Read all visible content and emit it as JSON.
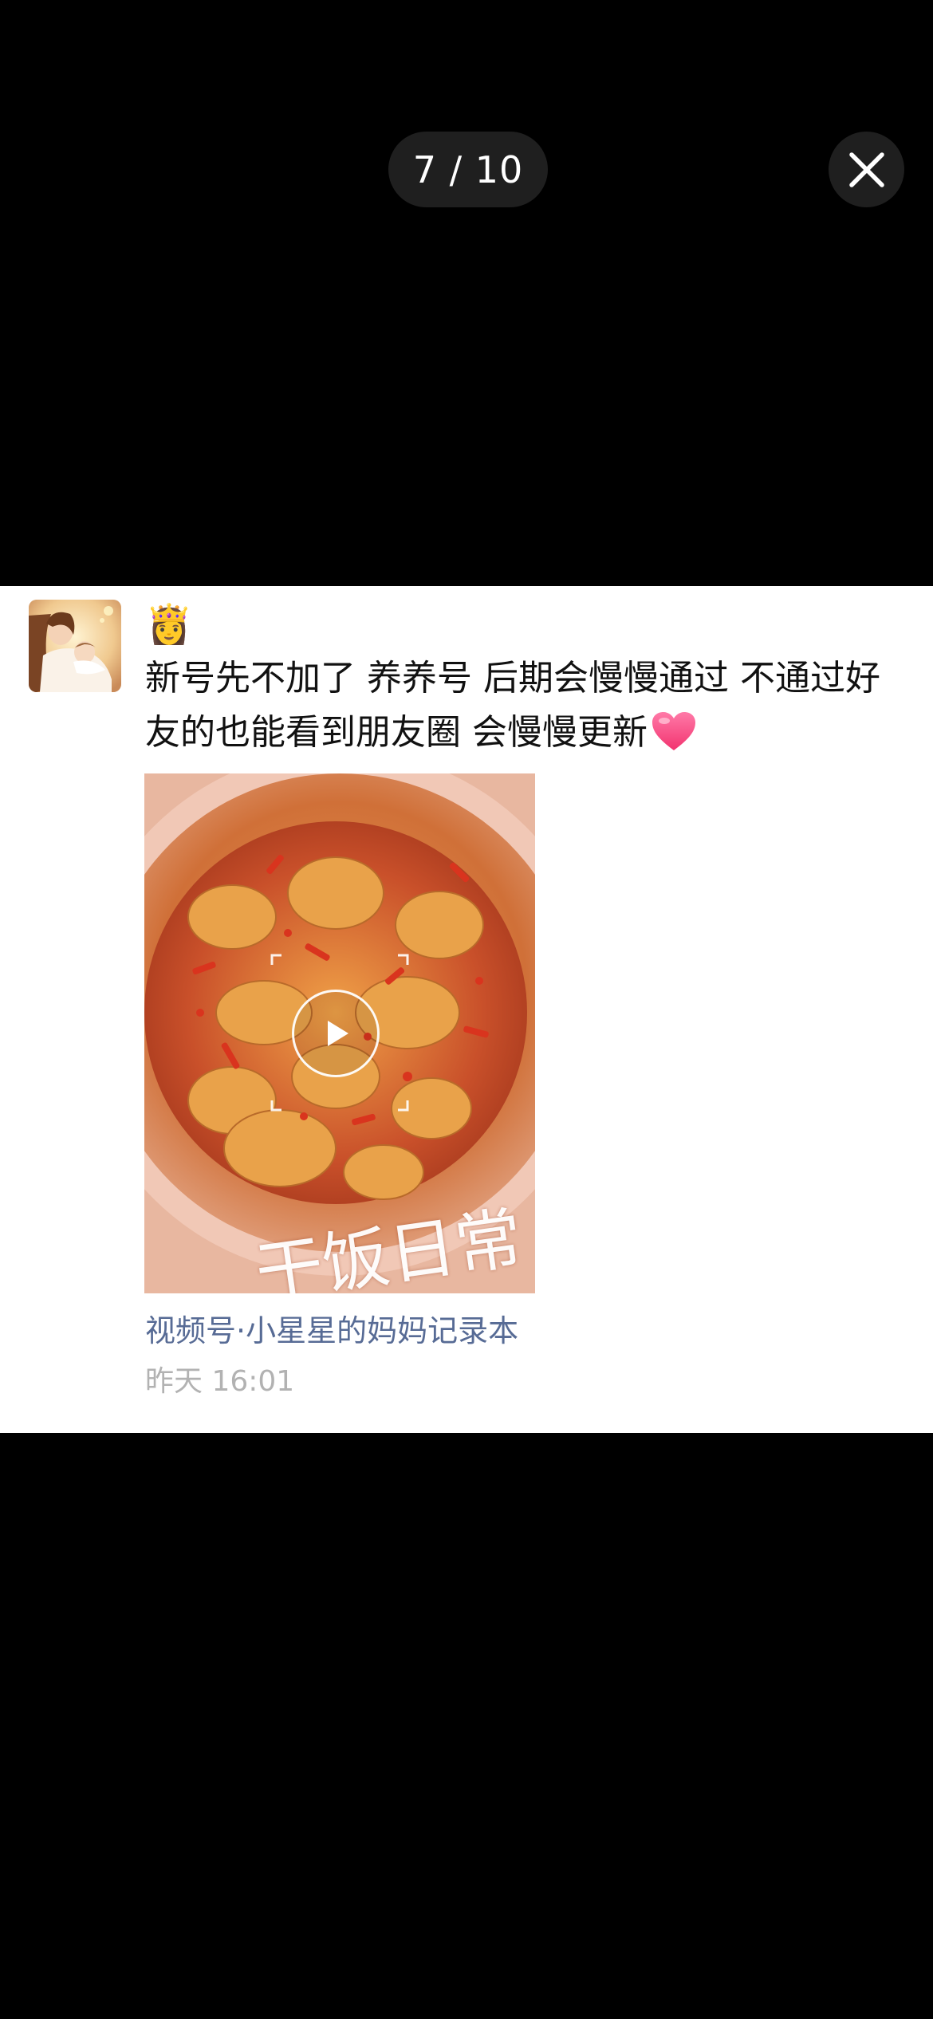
{
  "viewer": {
    "counter": "7 / 10"
  },
  "post": {
    "name_emoji": "👸",
    "text": "新号先不加了 养养号 后期会慢慢通过 不通过好友的也能看到朋友圈 会慢慢更新",
    "video": {
      "overlay_text": "干饭日常"
    },
    "source_link": "视频号·小星星的妈妈记录本",
    "timestamp": "昨天 16:01"
  },
  "colors": {
    "background": "#000000",
    "card": "#ffffff",
    "link": "#576b95",
    "timestamp": "#b2b2b2",
    "chip": "#1f1f1f"
  }
}
